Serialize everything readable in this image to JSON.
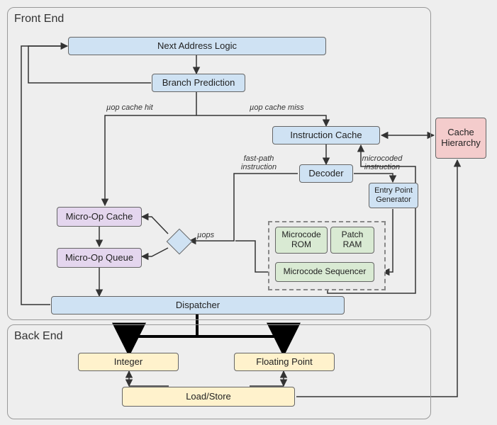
{
  "groups": {
    "front_end": "Front End",
    "back_end": "Back End"
  },
  "boxes": {
    "next_addr": "Next Address Logic",
    "branch_pred": "Branch Prediction",
    "instr_cache": "Instruction Cache",
    "decoder": "Decoder",
    "entry_point_gen": "Entry Point Generator",
    "microcode_rom": "Microcode ROM",
    "patch_ram": "Patch RAM",
    "microcode_seq": "Microcode Sequencer",
    "uop_cache": "Micro-Op Cache",
    "uop_queue": "Micro-Op Queue",
    "dispatcher": "Dispatcher",
    "integer": "Integer",
    "fpu": "Floating Point",
    "load_store": "Load/Store",
    "cache_hier": "Cache Hierarchy"
  },
  "labels": {
    "uop_hit": "µop cache hit",
    "uop_miss": "µop cache miss",
    "fast_path": "fast-path instruction",
    "microcoded": "microcoded instruction",
    "uops": "µops"
  }
}
